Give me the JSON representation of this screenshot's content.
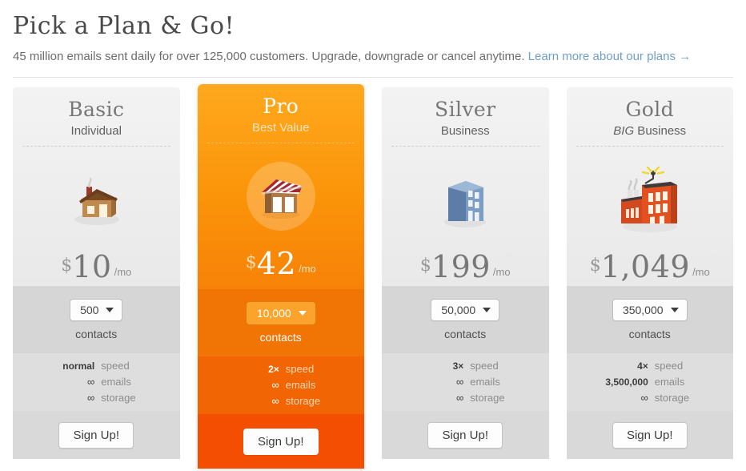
{
  "header": {
    "title": "Pick a Plan & Go!",
    "subtitle": "45 million emails sent daily for over 125,000 customers. Upgrade, downgrade or cancel anytime.",
    "link_text": "Learn more about our plans",
    "link_arrow": "→",
    "link_color": "#6e9ec9"
  },
  "labels": {
    "contacts": "contacts",
    "signup": "Sign Up!",
    "currency": "$",
    "period": "/mo",
    "speed": "speed",
    "emails": "emails",
    "storage": "storage",
    "caret": "chevron-down-icon"
  },
  "plans": [
    {
      "name": "Basic",
      "tagline": "Individual",
      "tagline_em": "",
      "tagline_rest": "Individual",
      "icon": "house-icon",
      "price": "10",
      "contacts": "500",
      "speed": "normal",
      "emails": "∞",
      "storage": "∞",
      "featured": false
    },
    {
      "name": "Pro",
      "tagline": "Best Value",
      "tagline_em": "",
      "tagline_rest": "Best Value",
      "icon": "shop-awning-icon",
      "price": "42",
      "contacts": "10,000",
      "speed": "2×",
      "emails": "∞",
      "storage": "∞",
      "featured": true
    },
    {
      "name": "Silver",
      "tagline": "Business",
      "tagline_em": "",
      "tagline_rest": "Business",
      "icon": "office-building-icon",
      "price": "199",
      "contacts": "50,000",
      "speed": "3×",
      "emails": "∞",
      "storage": "∞",
      "featured": false
    },
    {
      "name": "Gold",
      "tagline": "BIG Business",
      "tagline_em": "BIG",
      "tagline_rest": " Business",
      "icon": "factory-icon",
      "price": "1,049",
      "contacts": "350,000",
      "speed": "4×",
      "emails": "3,500,000",
      "storage": "∞",
      "featured": false
    }
  ],
  "colors": {
    "featured_orange": "#fb9409",
    "featured_deep": "#f44e03",
    "card_gray": "#e9e9e9"
  }
}
